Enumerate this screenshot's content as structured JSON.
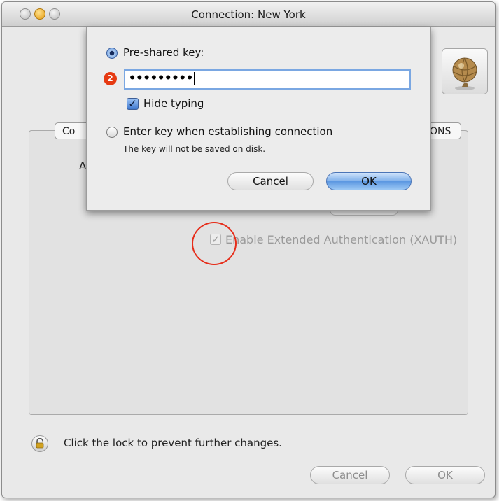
{
  "window": {
    "title": "Connection: New York"
  },
  "tabs": {
    "left_fragment": "Co",
    "right_fragment": "ONS"
  },
  "panel": {
    "label_fragment": "A"
  },
  "xauth": {
    "label": "Enable Extended Authentication (XAUTH)",
    "checked": true,
    "enabled": false
  },
  "footer": {
    "lock_text": "Click the lock to prevent further changes.",
    "cancel_label": "Cancel",
    "ok_label": "OK"
  },
  "sheet": {
    "option_psk_label": "Pre-shared key:",
    "step_badge": "2",
    "password_value": "•••••••••",
    "hide_typing_label": "Hide typing",
    "option_enter_label": "Enter key when establishing connection",
    "note": "The key will not be saved on disk.",
    "cancel_label": "Cancel",
    "ok_label": "OK",
    "selected_option": "Pre-shared key",
    "hide_typing_checked": true
  },
  "icons": [
    "network-globe-icon",
    "lock-icon",
    "checkmark-icon"
  ]
}
